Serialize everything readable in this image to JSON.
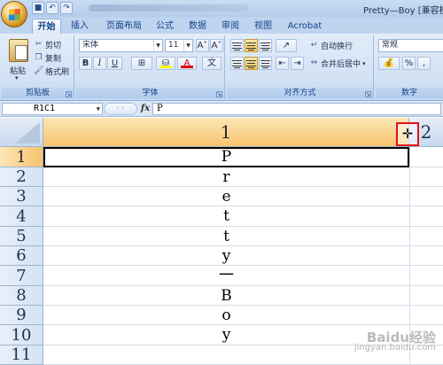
{
  "window": {
    "title": "Pretty—Boy  [兼容模",
    "qat": [
      "save-icon",
      "undo-icon",
      "redo-icon"
    ]
  },
  "tabs": [
    "开始",
    "插入",
    "页面布局",
    "公式",
    "数据",
    "审阅",
    "视图",
    "Acrobat"
  ],
  "ribbon": {
    "clipboard": {
      "label": "剪贴板",
      "paste": "粘贴",
      "cut": "剪切",
      "copy": "复制",
      "format_painter": "格式刷"
    },
    "font": {
      "label": "字体",
      "name": "宋体",
      "size": "11",
      "grow": "A˄",
      "shrink": "A˅",
      "bold": "B",
      "italic": "I",
      "underline": "U",
      "wen": "文"
    },
    "alignment": {
      "label": "对齐方式",
      "wrap": "自动换行",
      "merge": "合并后居中"
    },
    "number": {
      "label": "数字",
      "format": "常规",
      "percent": "%",
      "comma": ","
    }
  },
  "formula_bar": {
    "name_box": "R1C1",
    "fx": "fx",
    "value": "P"
  },
  "sheet": {
    "columns": [
      "1",
      "2"
    ],
    "rows": [
      {
        "num": "1",
        "value": "P"
      },
      {
        "num": "2",
        "value": "r"
      },
      {
        "num": "3",
        "value": "e"
      },
      {
        "num": "4",
        "value": "t"
      },
      {
        "num": "5",
        "value": "t"
      },
      {
        "num": "6",
        "value": "y"
      },
      {
        "num": "7",
        "value": "一"
      },
      {
        "num": "8",
        "value": "B"
      },
      {
        "num": "9",
        "value": "o"
      },
      {
        "num": "10",
        "value": "y"
      },
      {
        "num": "11",
        "value": ""
      }
    ]
  },
  "watermark": {
    "brand": "Baidu经验",
    "url": "jingyan.baidu.com"
  },
  "colors": {
    "selected_header": "#f7c26e",
    "highlight_box": "#e2121a"
  }
}
